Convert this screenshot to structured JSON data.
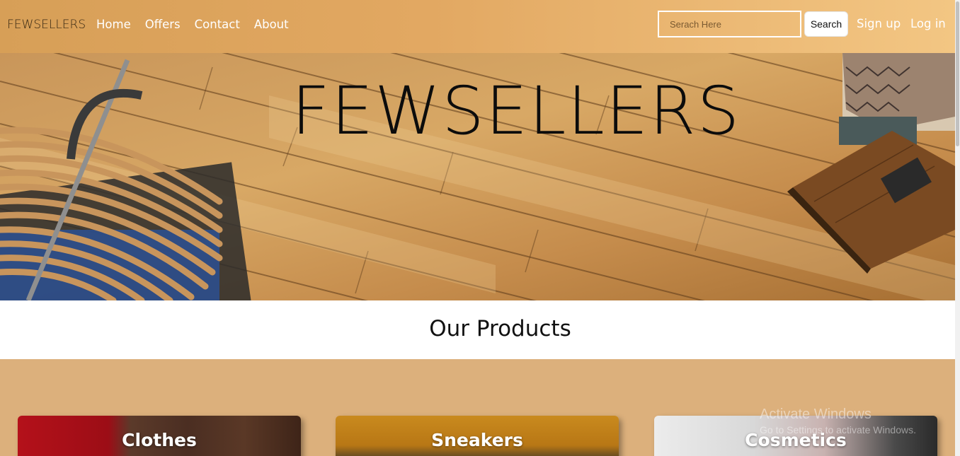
{
  "navbar": {
    "brand": "FEWSELLERS",
    "links": [
      "Home",
      "Offers",
      "Contact",
      "About"
    ],
    "search_placeholder": "Serach Here",
    "search_button": "Search",
    "signup": "Sign up",
    "login": "Log in"
  },
  "hero": {
    "title": "FEWSELLERS"
  },
  "products": {
    "heading": "Our Products",
    "cards": [
      "Clothes",
      "Sneakers",
      "Cosmetics"
    ]
  },
  "watermark": {
    "title": "Activate Windows",
    "subtitle": "Go to Settings to activate Windows."
  },
  "colors": {
    "navbar_gradient_start": "#d79f57",
    "navbar_gradient_end": "#f3c683",
    "products_background": "#dcb07c"
  }
}
